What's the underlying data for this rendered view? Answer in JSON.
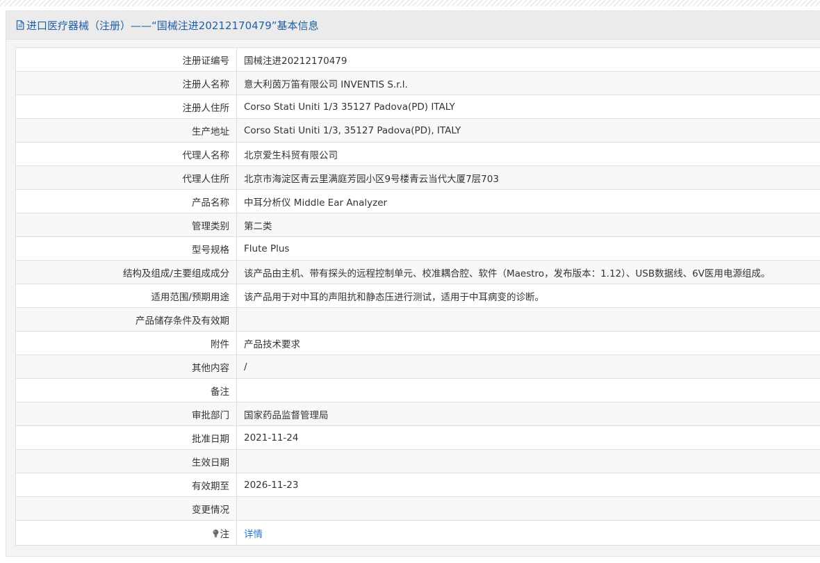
{
  "header": {
    "icon": "document-icon",
    "title_prefix": "进口医疗器械（注册）——",
    "title_main": "“国械注进20212170479”基本信息"
  },
  "rows": [
    {
      "label": "注册证编号",
      "value": "国械注进20212170479"
    },
    {
      "label": "注册人名称",
      "value": "意大利茵万笛有限公司 INVENTIS S.r.l."
    },
    {
      "label": "注册人住所",
      "value": "Corso Stati Uniti 1/3 35127 Padova(PD) ITALY"
    },
    {
      "label": "生产地址",
      "value": "Corso Stati Uniti 1/3, 35127 Padova(PD), ITALY"
    },
    {
      "label": "代理人名称",
      "value": "北京爱生科贸有限公司"
    },
    {
      "label": "代理人住所",
      "value": "北京市海淀区青云里满庭芳园小区9号楼青云当代大厦7层703"
    },
    {
      "label": "产品名称",
      "value": "中耳分析仪 Middle Ear Analyzer"
    },
    {
      "label": "管理类别",
      "value": "第二类"
    },
    {
      "label": "型号规格",
      "value": "Flute Plus"
    },
    {
      "label": "结构及组成/主要组成成分",
      "value": "该产品由主机、带有探头的远程控制单元、校准耦合腔、软件（Maestro，发布版本：1.12）、USB数据线、6V医用电源组成。"
    },
    {
      "label": "适用范围/预期用途",
      "value": "该产品用于对中耳的声阻抗和静态压进行测试，适用于中耳病变的诊断。"
    },
    {
      "label": "产品储存条件及有效期",
      "value": ""
    },
    {
      "label": "附件",
      "value": "产品技术要求"
    },
    {
      "label": "其他内容",
      "value": "/"
    },
    {
      "label": "备注",
      "value": ""
    },
    {
      "label": "审批部门",
      "value": "国家药品监督管理局"
    },
    {
      "label": "批准日期",
      "value": "2021-11-24"
    },
    {
      "label": "生效日期",
      "value": ""
    },
    {
      "label": "有效期至",
      "value": "2026-11-23"
    },
    {
      "label": "变更情况",
      "value": ""
    }
  ],
  "note": {
    "icon": "lightbulb-icon",
    "label": "注",
    "link_text": "详情"
  }
}
